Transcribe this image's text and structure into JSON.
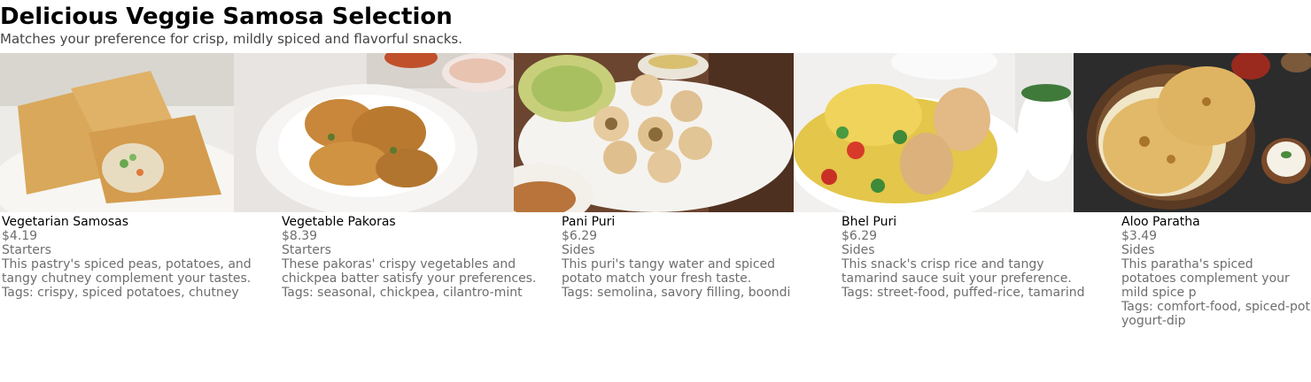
{
  "page": {
    "title": "Delicious Veggie Samosa Selection",
    "subtitle": "Matches your preference for crisp, mildly spiced and flavorful snacks."
  },
  "items": [
    {
      "name": "Vegetarian Samosas",
      "price": "$4.19",
      "category": "Starters",
      "description": "This pastry's spiced peas, potatoes, and tangy chutney complement your tastes.",
      "tags": "Tags: crispy, spiced potatoes, chutney",
      "image_icon": "samosa-photo"
    },
    {
      "name": "Vegetable Pakoras",
      "price": "$8.39",
      "category": "Starters",
      "description": "These pakoras' crispy vegetables and chickpea batter satisfy your preferences.",
      "tags": "Tags: seasonal, chickpea, cilantro-mint",
      "image_icon": "pakora-photo"
    },
    {
      "name": "Pani Puri",
      "price": "$6.29",
      "category": "Sides",
      "description": "This puri's tangy water and spiced potato match your fresh taste.",
      "tags": "Tags: semolina, savory filling, boondi",
      "image_icon": "pani-puri-photo"
    },
    {
      "name": "Bhel Puri",
      "price": "$6.29",
      "category": "Sides",
      "description": "This snack's crisp rice and tangy tamarind sauce suit your preference.",
      "tags": "Tags: street-food, puffed-rice, tamarind",
      "image_icon": "bhel-puri-photo"
    },
    {
      "name": "Aloo Paratha",
      "price": "$3.49",
      "category": "Sides",
      "description": "This paratha's spiced potatoes complement your mild spice p",
      "tags": "Tags: comfort-food, spiced-pot yogurt-dip",
      "image_icon": "aloo-paratha-photo"
    }
  ]
}
